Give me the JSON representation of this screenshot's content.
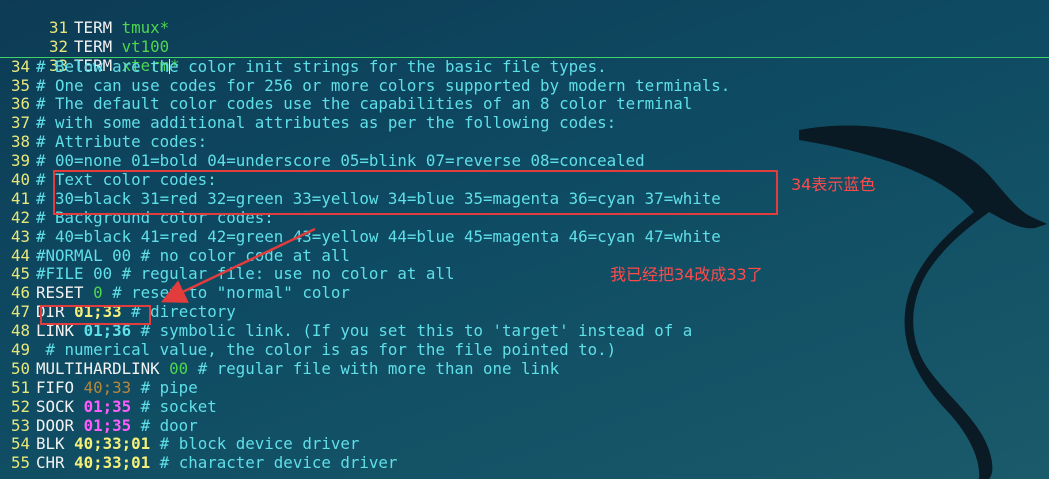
{
  "lines": [
    {
      "n": "31",
      "key": "TERM",
      "val": "tmux*",
      "rest": ""
    },
    {
      "n": "32",
      "key": "TERM",
      "val": "vt100",
      "rest": ""
    },
    {
      "n": "33",
      "key": "TERM",
      "val": "xterm",
      "rest": "*"
    },
    {
      "n": "34",
      "text": "# Below are the color init strings for the basic file types."
    },
    {
      "n": "35",
      "text": "# One can use codes for 256 or more colors supported by modern terminals."
    },
    {
      "n": "36",
      "text": "# The default color codes use the capabilities of an 8 color terminal"
    },
    {
      "n": "37",
      "text": "# with some additional attributes as per the following codes:"
    },
    {
      "n": "38",
      "text": "# Attribute codes:"
    },
    {
      "n": "39",
      "text": "# 00=none 01=bold 04=underscore 05=blink 07=reverse 08=concealed"
    },
    {
      "n": "40",
      "text": "# Text color codes:"
    },
    {
      "n": "41",
      "text": "# 30=black 31=red 32=green 33=yellow 34=blue 35=magenta 36=cyan 37=white"
    },
    {
      "n": "42",
      "text": "# Background color codes:"
    },
    {
      "n": "43",
      "text": "# 40=black 41=red 42=green 43=yellow 44=blue 45=magenta 46=cyan 47=white"
    },
    {
      "n": "44",
      "text": "#NORMAL 00 # no color code at all"
    },
    {
      "n": "45",
      "text": "#FILE 00 # regular file: use no color at all"
    },
    {
      "n": "46",
      "key": "RESET",
      "val": "0",
      "rest": " # reset to \"normal\" color"
    },
    {
      "n": "47",
      "key": "DIR",
      "val": "01;33",
      "rest": " # directory"
    },
    {
      "n": "48",
      "key": "LINK",
      "val": "01;36",
      "rest": " # symbolic link. (If you set this to 'target' instead of a"
    },
    {
      "n": "49",
      "text": " # numerical value, the color is as for the file pointed to.)"
    },
    {
      "n": "50",
      "key": "MULTIHARDLINK",
      "val": "00",
      "rest": " # regular file with more than one link"
    },
    {
      "n": "51",
      "key": "FIFO",
      "val": "40;33",
      "rest": " # pipe"
    },
    {
      "n": "52",
      "key": "SOCK",
      "val": "01;35",
      "rest": " # socket"
    },
    {
      "n": "53",
      "key": "DOOR",
      "val": "01;35",
      "rest": " # door"
    },
    {
      "n": "54",
      "key": "BLK",
      "val": "40;33;01",
      "rest": " # block device driver"
    },
    {
      "n": "55",
      "key": "CHR",
      "val": "40;33;01",
      "rest": " # character device driver"
    }
  ],
  "annotations": {
    "note_34_blue": "34表示蓝色",
    "note_changed": "我已经把34改成33了"
  },
  "colors": {
    "annotation_red": "#e23c3c",
    "comment_cyan": "#5fe0e8",
    "keyword_white": "#f2f2f2",
    "line_number_yellow": "#e8e87a"
  }
}
